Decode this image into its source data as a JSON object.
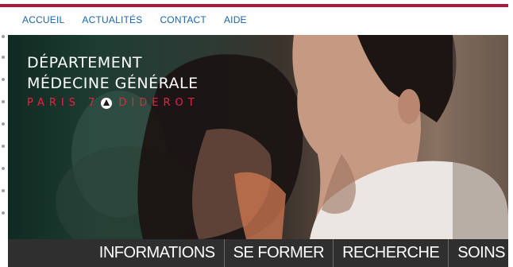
{
  "topnav": {
    "items": [
      "ACCUEIL",
      "ACTUALITÉS",
      "CONTACT",
      "AIDE"
    ]
  },
  "brand": {
    "line1": "DÉPARTEMENT",
    "line2": "MÉDECINE GÉNÉRALE",
    "sub_left": "PARIS 7",
    "sub_right": "DIDEROT"
  },
  "mainnav": {
    "items": [
      "INFORMATIONS",
      "SE FORMER",
      "RECHERCHE",
      "SOINS"
    ]
  },
  "colors": {
    "accent_rule": "#b0163f",
    "link": "#1a64b0",
    "brand_red": "#e8233d",
    "nav_bg": "#2f2f2f"
  }
}
